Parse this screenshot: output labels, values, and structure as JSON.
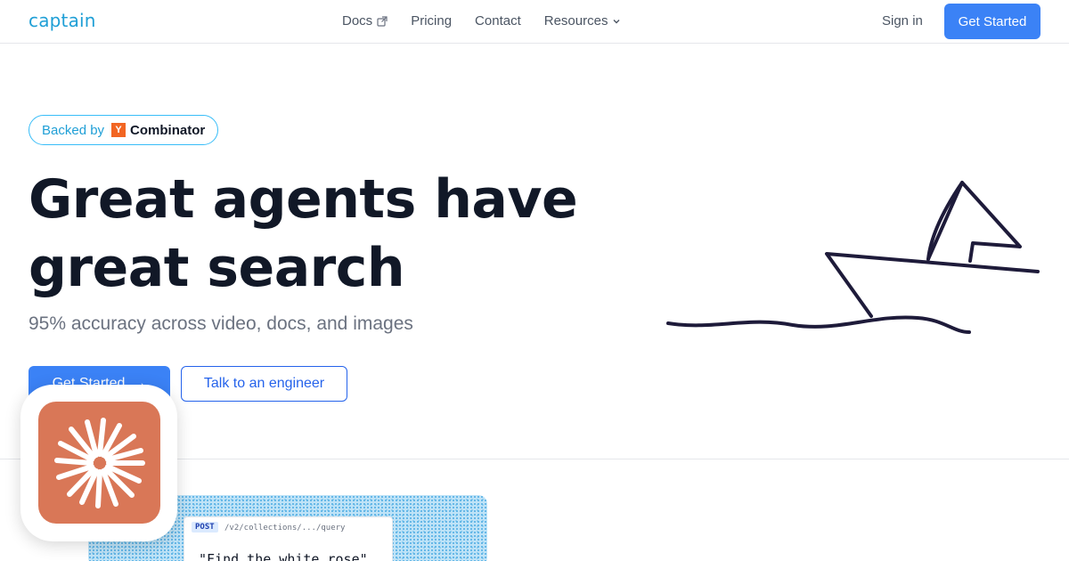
{
  "nav": {
    "logo": "captain",
    "links": [
      {
        "label": "Docs",
        "icon": "external-link-icon"
      },
      {
        "label": "Pricing"
      },
      {
        "label": "Contact"
      },
      {
        "label": "Resources",
        "icon": "chevron-down-icon"
      }
    ],
    "signin_label": "Sign in",
    "cta_label": "Get Started"
  },
  "badge": {
    "prefix": "Backed by",
    "icon_letter": "Y",
    "name": "Combinator",
    "icon_color": "#f26522"
  },
  "hero": {
    "title_line1": "Great agents have",
    "title_line2": "great search",
    "subtitle": "95% accuracy across video, docs, and images",
    "primary_cta": "Get Started",
    "primary_arrow": "→",
    "secondary_cta": "Talk to an engineer"
  },
  "demo": {
    "method": "POST",
    "endpoint": "/v2/collections/.../query",
    "query": "\"Find the white rose\""
  },
  "colors": {
    "accent": "#3b82f6",
    "logo": "#1f9fd6",
    "app_icon": "#d97757",
    "text_dark": "#111827",
    "text_muted": "#6b7280"
  }
}
